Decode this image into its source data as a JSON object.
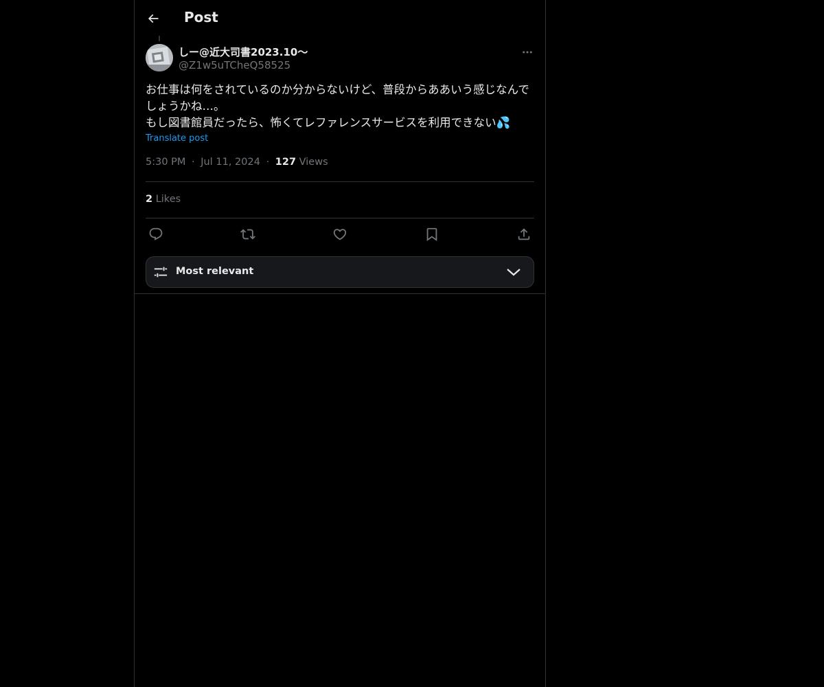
{
  "header": {
    "title": "Post",
    "back_icon": "arrow-left-icon"
  },
  "post": {
    "author": {
      "display_name": "しー@近大司書2023.10〜",
      "handle": "@Z1w5uTCheQ58525"
    },
    "text": "お仕事は何をされているのか分からないけど、普段からああいう感じなんでしょうかね…。\nもし図書館員だったら、怖くてレファレンスサービスを利用できない💦",
    "translate_label": "Translate post",
    "time": "5:30 PM",
    "separator": "·",
    "date": "Jul 11, 2024",
    "views_count": "127",
    "views_label": "Views",
    "likes_count": "2",
    "likes_label": "Likes"
  },
  "actions": [
    {
      "name": "reply",
      "icon": "reply-icon"
    },
    {
      "name": "repost",
      "icon": "repost-icon"
    },
    {
      "name": "like",
      "icon": "heart-icon"
    },
    {
      "name": "bookmark",
      "icon": "bookmark-icon"
    },
    {
      "name": "share",
      "icon": "share-icon"
    }
  ],
  "sort": {
    "label": "Most relevant",
    "icon": "sliders-icon",
    "chevron": "chevron-down-icon"
  },
  "colors": {
    "background": "#000000",
    "text": "#e7e9ea",
    "muted": "#71767b",
    "link": "#1d9bf0",
    "border": "#2f3336"
  }
}
